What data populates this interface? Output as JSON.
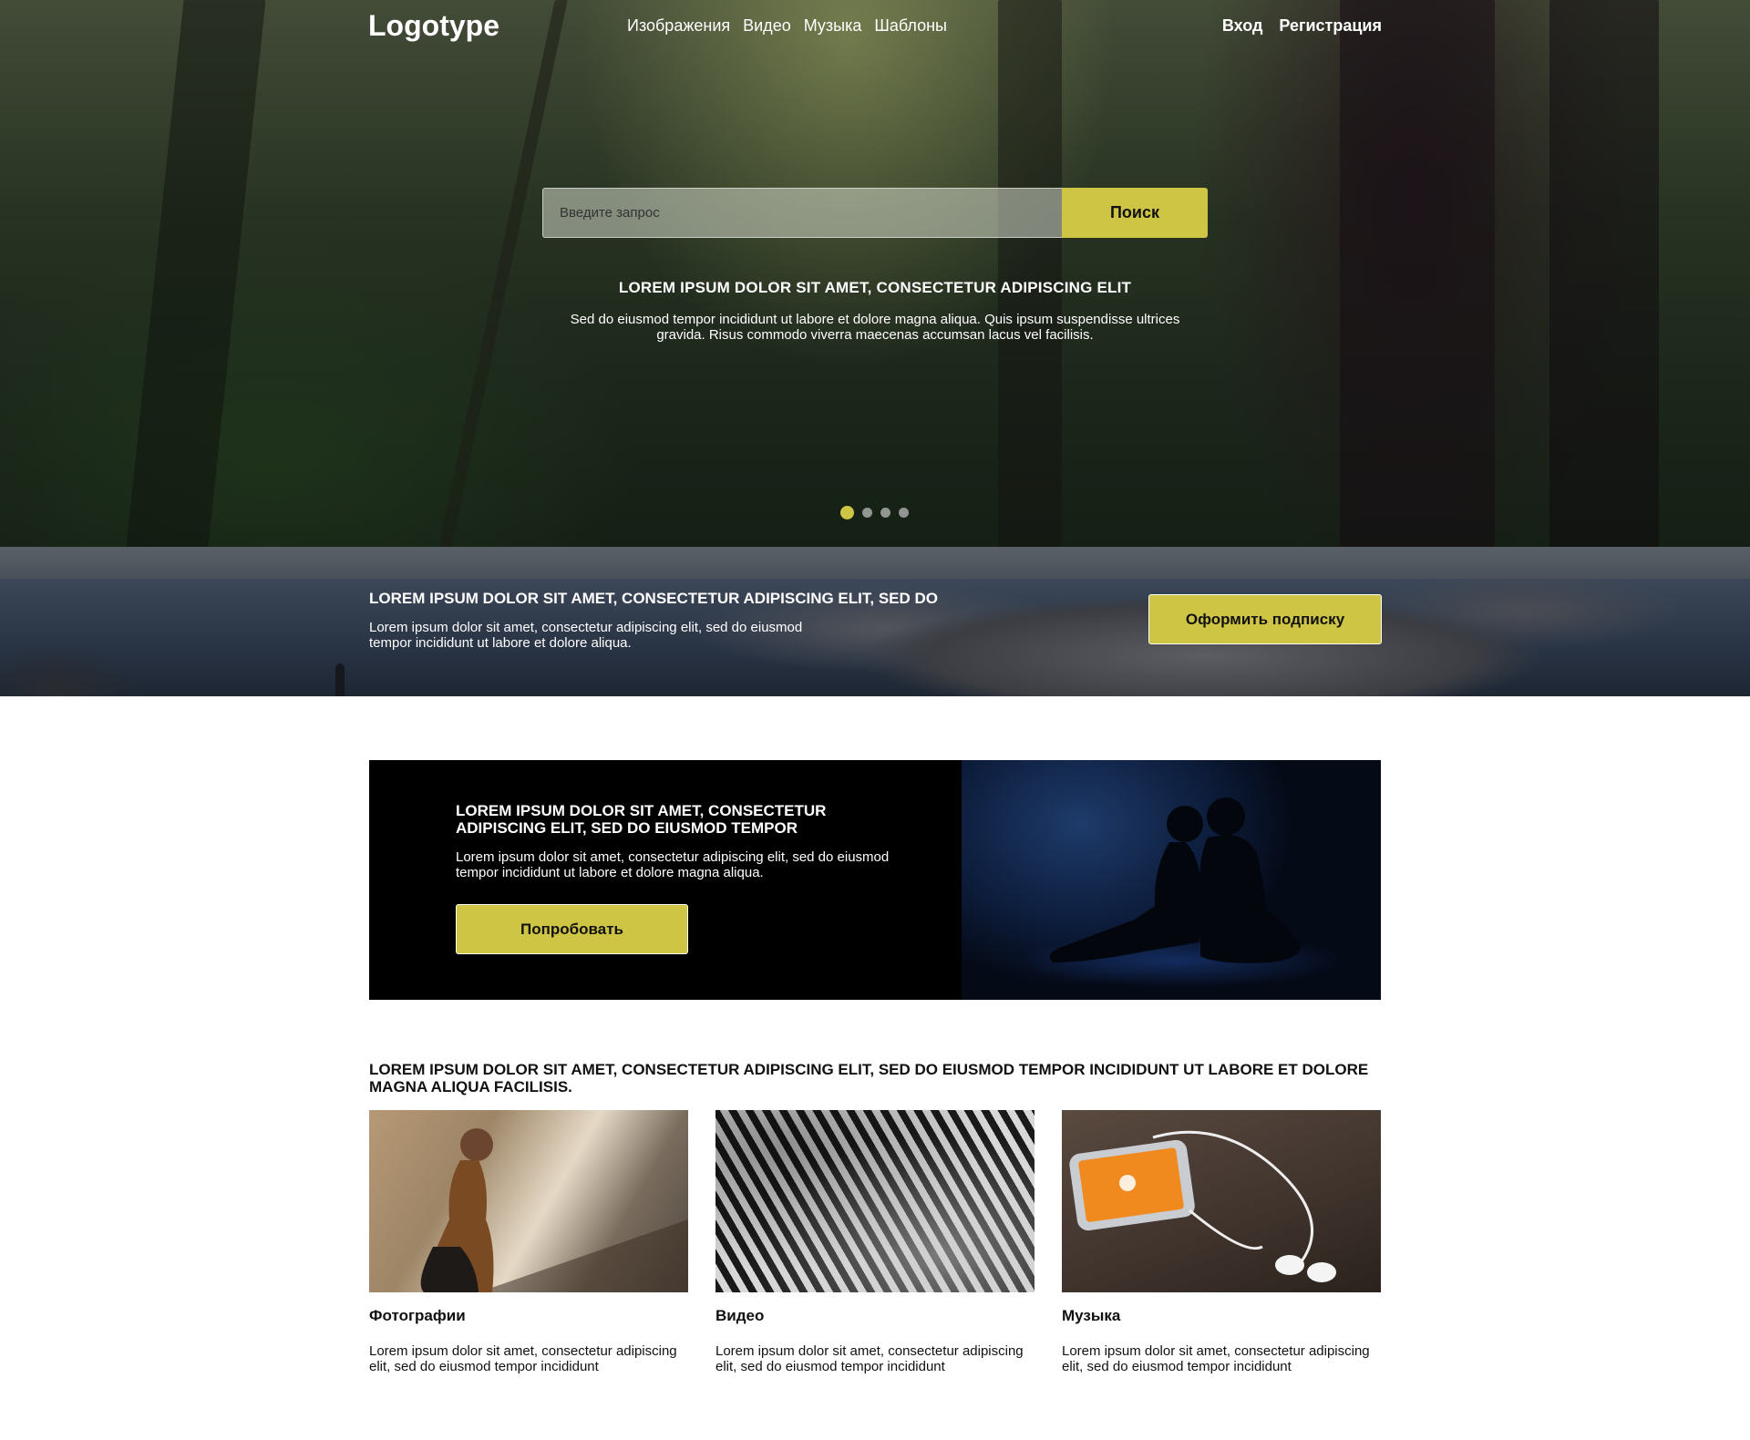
{
  "header": {
    "logo": "Logotype",
    "nav": [
      "Изображения",
      "Видео",
      "Музыка",
      "Шаблоны"
    ],
    "login": "Вход",
    "register": "Регистрация"
  },
  "search": {
    "placeholder": "Введите запрос",
    "button": "Поиск"
  },
  "hero": {
    "title": "LOREM IPSUM DOLOR SIT AMET, CONSECTETUR ADIPISCING ELIT",
    "text": "Sed do eiusmod tempor incididunt ut labore et dolore magna aliqua. Quis ipsum suspendisse ultrices gravida. Risus commodo viverra maecenas accumsan lacus vel facilisis.",
    "slides": 4,
    "active_slide": 1
  },
  "banner": {
    "title": "LOREM IPSUM DOLOR SIT AMET, CONSECTETUR ADIPISCING ELIT, SED DO",
    "text": "Lorem ipsum dolor sit amet, consectetur adipiscing elit, sed do eiusmod tempor incididunt ut labore et dolore aliqua.",
    "button": "Оформить подписку"
  },
  "promo": {
    "title": "LOREM IPSUM DOLOR SIT AMET, CONSECTETUR ADIPISCING ELIT, SED DO EIUSMOD TEMPOR",
    "text": "Lorem ipsum dolor sit amet, consectetur adipiscing elit, sed do eiusmod tempor incididunt ut labore et dolore magna aliqua.",
    "button": "Попробовать"
  },
  "cards_section": {
    "heading": "LOREM IPSUM DOLOR SIT AMET, CONSECTETUR ADIPISCING ELIT, SED DO EIUSMOD TEMPOR INCIDIDUNT UT LABORE ET DOLORE MAGNA ALIQUA FACILISIS.",
    "cards": [
      {
        "title": "Фотографии",
        "text": "Lorem ipsum dolor sit amet, consectetur adipiscing elit, sed do eiusmod tempor incididunt"
      },
      {
        "title": "Видео",
        "text": "Lorem ipsum dolor sit amet, consectetur adipiscing elit, sed do eiusmod tempor incididunt"
      },
      {
        "title": "Музыка",
        "text": "Lorem ipsum dolor sit amet, consectetur adipiscing elit, sed do eiusmod tempor incididunt"
      }
    ]
  },
  "colors": {
    "accent": "#cfc544",
    "promo_bg": "#000000",
    "text_light": "#ffffff",
    "text_dark": "#111111"
  }
}
